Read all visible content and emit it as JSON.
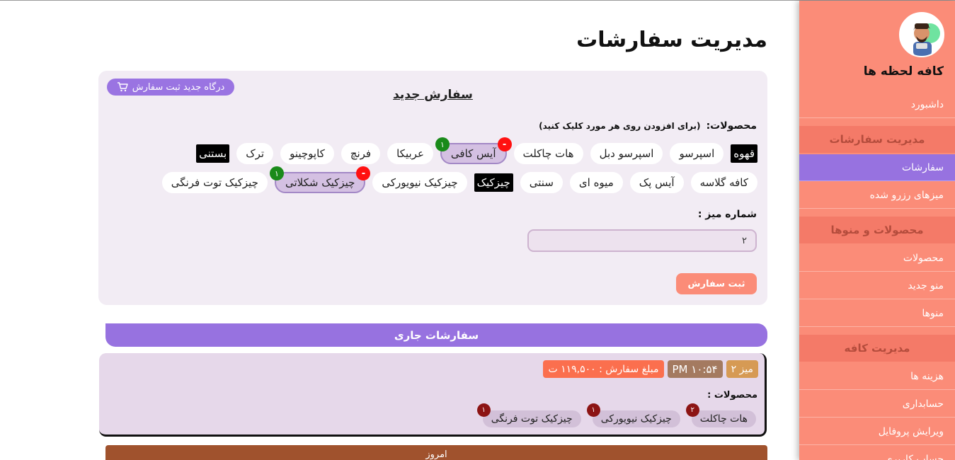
{
  "page": {
    "title": "مدیریت سفارشات"
  },
  "sidebar": {
    "cafe_name": "کافه لحظه ها",
    "dashboard": "داشبورد",
    "sections": [
      {
        "heading": "مدیریت سفارشات",
        "items": [
          "سفارشات",
          "میزهای رزرو شده"
        ]
      },
      {
        "heading": "محصولات و منوها",
        "items": [
          "محصولات",
          "منو جدید",
          "منوها"
        ]
      },
      {
        "heading": "مدیریت کافه",
        "items": [
          "هزینه ها",
          "حسابداری",
          "ویرایش پروفایل",
          "حساب کاربری"
        ]
      }
    ],
    "active_item": "سفارشات",
    "colors": {
      "background": "#fb8c78",
      "active": "#9772e0"
    }
  },
  "new_order": {
    "title": "سفارش جدید",
    "gateway_button": "درگاه جدید ثبت سفارش",
    "products_label": "محصولات:",
    "products_hint": "(برای افزودن روی هر مورد کلیک کنید)",
    "row1": [
      {
        "label": "قهوه",
        "type": "category"
      },
      {
        "label": "اسپرسو"
      },
      {
        "label": "اسپرسو دبل"
      },
      {
        "label": "هات چاکلت"
      },
      {
        "label": "آیس کافی",
        "selected": true,
        "count": "۱",
        "minus": "-"
      },
      {
        "label": "عربیکا"
      },
      {
        "label": "فرنچ"
      },
      {
        "label": "کاپوچینو"
      },
      {
        "label": "ترک"
      },
      {
        "label": "بستنی",
        "type": "category"
      }
    ],
    "row2": [
      {
        "label": "کافه گلاسه"
      },
      {
        "label": "آیس پک"
      },
      {
        "label": "میوه ای"
      },
      {
        "label": "سنتی"
      },
      {
        "label": "چیزکیک",
        "type": "category"
      },
      {
        "label": "چیزکیک نیویورکی"
      },
      {
        "label": "چیزکیک شکلاتی",
        "selected": true,
        "count": "۱",
        "minus": "-"
      },
      {
        "label": "چیزکیک توت فرنگی"
      }
    ],
    "table_label": "شماره میز :",
    "table_value": "۲",
    "submit_button": "ثبت سفارش"
  },
  "current_orders": {
    "title": "سفارشات جاری",
    "orders": [
      {
        "table": "میز ۲",
        "time": "۱۰:۵۴ PM",
        "amount": "مبلغ سفارش : ۱۱۹,۵۰۰ ت",
        "products_label": "محصولات :",
        "items": [
          {
            "name": "هات چاکلت",
            "qty": "۲"
          },
          {
            "name": "چیزکیک نیویورکی",
            "qty": "۱"
          },
          {
            "name": "چیزکیک توت فرنگی",
            "qty": "۱"
          }
        ]
      }
    ]
  },
  "today": {
    "title": "امروز"
  }
}
